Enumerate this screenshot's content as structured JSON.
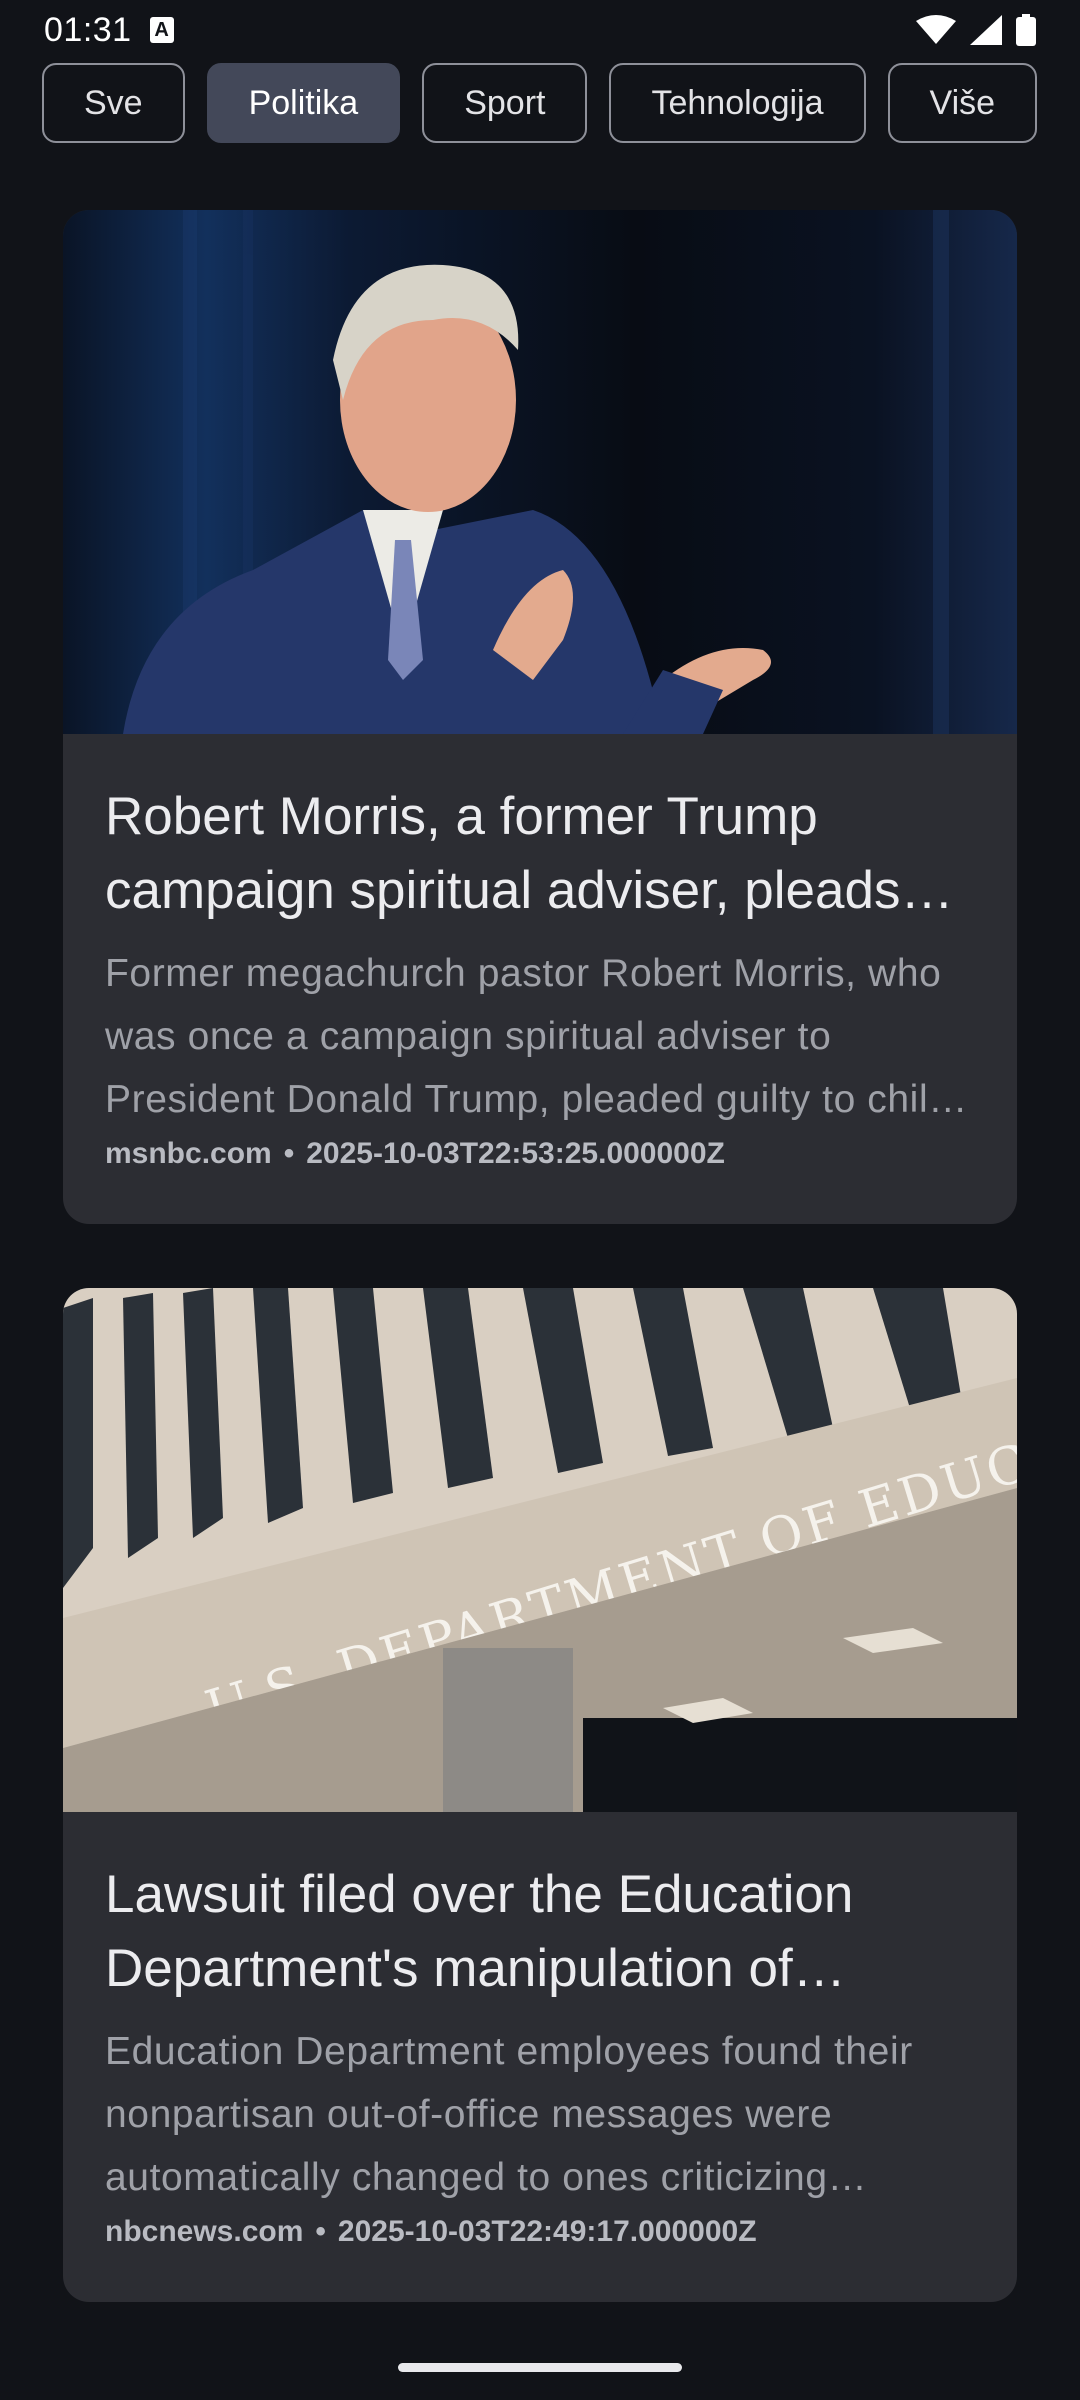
{
  "status_bar": {
    "time": "01:31",
    "notification_icon": "a-box-icon",
    "icons": [
      "wifi-icon",
      "signal-icon",
      "battery-icon"
    ]
  },
  "categories": [
    {
      "label": "Sve",
      "selected": false
    },
    {
      "label": "Politika",
      "selected": true
    },
    {
      "label": "Sport",
      "selected": false
    },
    {
      "label": "Tehnologija",
      "selected": false
    },
    {
      "label": "Više",
      "selected": false
    }
  ],
  "articles": [
    {
      "title": "Robert Morris, a former Trump campaign spiritual adviser, pleads guilty",
      "description": "Former megachurch pastor Robert Morris, who was once a campaign spiritual adviser to President Donald Trump, pleaded guilty to child sex abuse charges",
      "source": "msnbc.com",
      "separator": "•",
      "timestamp": "2025-10-03T22:53:25.000000Z"
    },
    {
      "title": "Lawsuit filed over the Education Department's manipulation of employee emails",
      "description": "Education Department employees found their nonpartisan out-of-office messages were automatically changed to ones criticizing Democrats",
      "source": "nbcnews.com",
      "separator": "•",
      "timestamp": "2025-10-03T22:49:17.000000Z"
    }
  ],
  "colors": {
    "background": "#111318",
    "card": "#2c2d33",
    "chip_selected": "#434859",
    "chip_border": "#8e9099"
  }
}
